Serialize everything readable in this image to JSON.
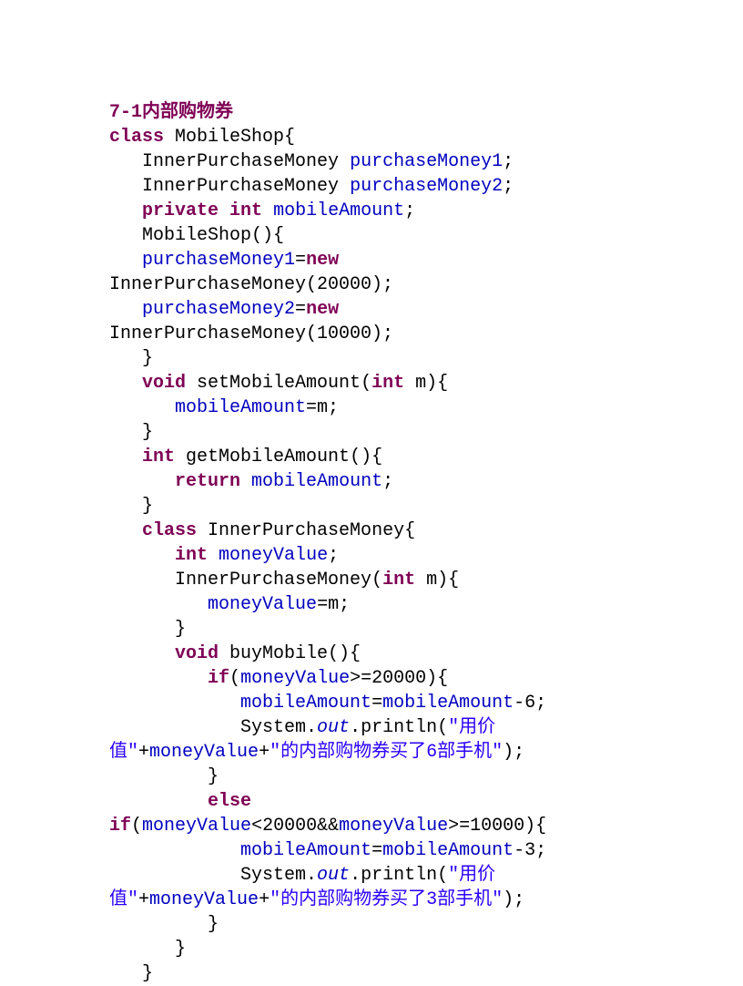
{
  "code": {
    "title": "7-1内部购物券",
    "l01a": "class",
    "l01b": " MobileShop{",
    "l02a": "   InnerPurchaseMoney ",
    "l02b": "purchaseMoney1",
    "l02c": ";",
    "l03a": "   InnerPurchaseMoney ",
    "l03b": "purchaseMoney2",
    "l03c": ";",
    "l04a": "   ",
    "l04b": "private",
    "l04c": " ",
    "l04d": "int",
    "l04e": " ",
    "l04f": "mobileAmount",
    "l04g": ";",
    "l05": "   MobileShop(){",
    "l06a": "   ",
    "l06b": "purchaseMoney1",
    "l06c": "=",
    "l06d": "new",
    "l06e": " InnerPurchaseMoney(20000);",
    "l07a": "   ",
    "l07b": "purchaseMoney2",
    "l07c": "=",
    "l07d": "new",
    "l07e": " InnerPurchaseMoney(10000);",
    "l08": "   }",
    "l09a": "   ",
    "l09b": "void",
    "l09c": " setMobileAmount(",
    "l09d": "int",
    "l09e": " m){",
    "l10a": "      ",
    "l10b": "mobileAmount",
    "l10c": "=m;",
    "l11": "   }",
    "l12a": "   ",
    "l12b": "int",
    "l12c": " getMobileAmount(){",
    "l13a": "      ",
    "l13b": "return",
    "l13c": " ",
    "l13d": "mobileAmount",
    "l13e": ";",
    "l14": "   }",
    "l15a": "   ",
    "l15b": "class",
    "l15c": " InnerPurchaseMoney{",
    "l16a": "      ",
    "l16b": "int",
    "l16c": " ",
    "l16d": "moneyValue",
    "l16e": ";",
    "l17a": "      InnerPurchaseMoney(",
    "l17b": "int",
    "l17c": " m){",
    "l18a": "         ",
    "l18b": "moneyValue",
    "l18c": "=m;",
    "l19": "      }",
    "l20a": "      ",
    "l20b": "void",
    "l20c": " buyMobile(){",
    "l21a": "         ",
    "l21b": "if",
    "l21c": "(",
    "l21d": "moneyValue",
    "l21e": ">=20000){",
    "l22a": "            ",
    "l22b": "mobileAmount",
    "l22c": "=",
    "l22d": "mobileAmount",
    "l22e": "-6;",
    "l23a": "            System.",
    "l23b": "out",
    "l23c": ".println(",
    "l23d": "\"用价值\"",
    "l23e": "+",
    "l23f": "moneyValue",
    "l23g": "+",
    "l23h": "\"的内部购物券买了6部手机\"",
    "l23i": ");",
    "l24": "         }",
    "l25a": "         ",
    "l25b": "else",
    "l26a": "if",
    "l26b": "(",
    "l26c": "moneyValue",
    "l26d": "<20000&&",
    "l26e": "moneyValue",
    "l26f": ">=10000){",
    "l27a": "            ",
    "l27b": "mobileAmount",
    "l27c": "=",
    "l27d": "mobileAmount",
    "l27e": "-3;",
    "l28a": "            System.",
    "l28b": "out",
    "l28c": ".println(",
    "l28d": "\"用价值\"",
    "l28e": "+",
    "l28f": "moneyValue",
    "l28g": "+",
    "l28h": "\"的内部购物券买了3部手机\"",
    "l28i": ");",
    "l29": "         }",
    "l30": "      }",
    "l31": "   }"
  }
}
